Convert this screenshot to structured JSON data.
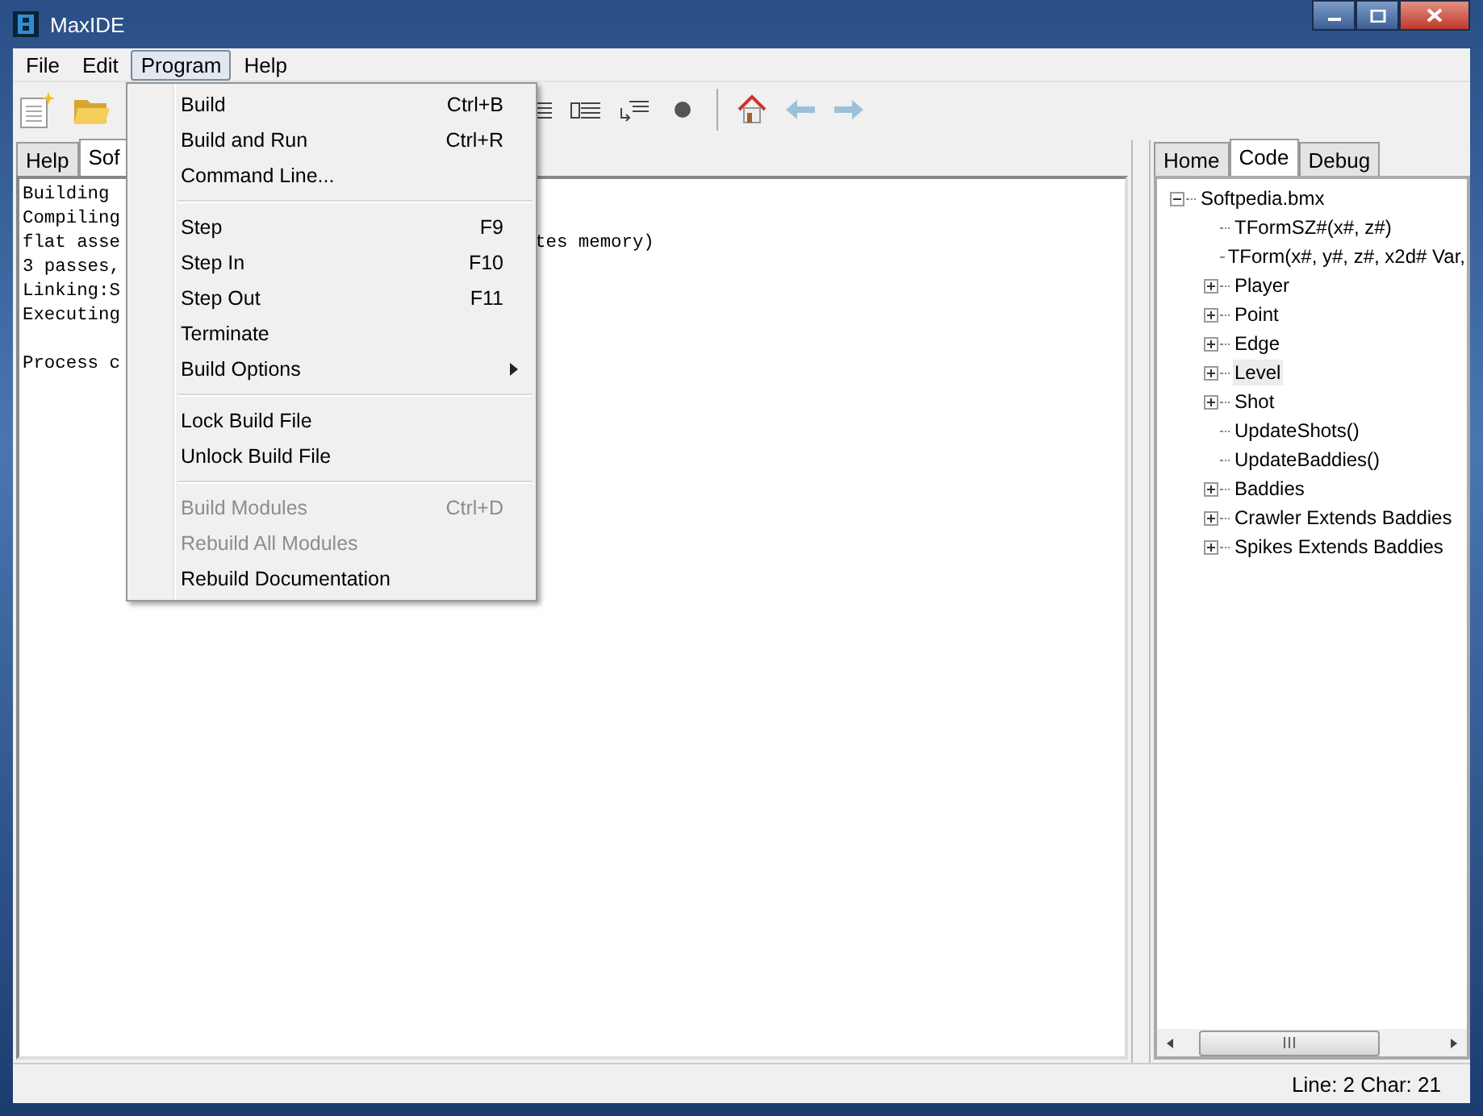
{
  "window": {
    "title": "MaxIDE"
  },
  "menubar": [
    {
      "label": "File",
      "selected": false
    },
    {
      "label": "Edit",
      "selected": false
    },
    {
      "label": "Program",
      "selected": true
    },
    {
      "label": "Help",
      "selected": false
    }
  ],
  "program_menu": [
    [
      {
        "label": "Build",
        "shortcut": "Ctrl+B",
        "disabled": false,
        "submenu": false
      },
      {
        "label": "Build and Run",
        "shortcut": "Ctrl+R",
        "disabled": false,
        "submenu": false
      },
      {
        "label": "Command Line...",
        "disabled": false,
        "submenu": false
      }
    ],
    [
      {
        "label": "Step",
        "shortcut": "F9",
        "disabled": false,
        "submenu": false
      },
      {
        "label": "Step In",
        "shortcut": "F10",
        "disabled": false,
        "submenu": false
      },
      {
        "label": "Step Out",
        "shortcut": "F11",
        "disabled": false,
        "submenu": false
      },
      {
        "label": "Terminate",
        "disabled": false,
        "submenu": false
      },
      {
        "label": "Build Options",
        "disabled": false,
        "submenu": true
      }
    ],
    [
      {
        "label": "Lock Build File",
        "disabled": false,
        "submenu": false
      },
      {
        "label": "Unlock Build File",
        "disabled": false,
        "submenu": false
      }
    ],
    [
      {
        "label": "Build Modules",
        "shortcut": "Ctrl+D",
        "disabled": true,
        "submenu": false
      },
      {
        "label": "Rebuild All Modules",
        "disabled": true,
        "submenu": false
      },
      {
        "label": "Rebuild Documentation",
        "disabled": false,
        "submenu": false
      }
    ]
  ],
  "editor_tabs": [
    {
      "label": "Help",
      "selected": false
    },
    {
      "label": "Sof",
      "selected": true
    }
  ],
  "console": [
    {
      "text": "Building"
    },
    {
      "text": "Compiling"
    },
    {
      "text": "flat asse",
      "tail": "tes memory)"
    },
    {
      "text": "3 passes,"
    },
    {
      "text": "Linking:S"
    },
    {
      "text": "Executing"
    },
    {
      "text": "Process c",
      "gap_before": true
    }
  ],
  "side_tabs": [
    {
      "label": "Home",
      "selected": false
    },
    {
      "label": "Code",
      "selected": true
    },
    {
      "label": "Debug",
      "selected": false
    }
  ],
  "tree": {
    "label": "Softpedia.bmx",
    "expanded": true,
    "children": [
      {
        "label": "TFormSZ#(x#, z#)",
        "expandable": false,
        "selected": false
      },
      {
        "label": "TForm(x#, y#, z#, x2d# Var,",
        "expandable": false,
        "selected": false
      },
      {
        "label": "Player",
        "expandable": true,
        "selected": false
      },
      {
        "label": "Point",
        "expandable": true,
        "selected": false
      },
      {
        "label": "Edge",
        "expandable": true,
        "selected": false
      },
      {
        "label": "Level",
        "expandable": true,
        "selected": true
      },
      {
        "label": "Shot",
        "expandable": true,
        "selected": false
      },
      {
        "label": "UpdateShots()",
        "expandable": false,
        "selected": false
      },
      {
        "label": "UpdateBaddies()",
        "expandable": false,
        "selected": false
      },
      {
        "label": "Baddies",
        "expandable": true,
        "selected": false
      },
      {
        "label": "Crawler Extends Baddies",
        "expandable": true,
        "selected": false
      },
      {
        "label": "Spikes Extends Baddies",
        "expandable": true,
        "selected": false
      }
    ]
  },
  "status_bar": {
    "position": "Line: 2 Char: 21"
  }
}
